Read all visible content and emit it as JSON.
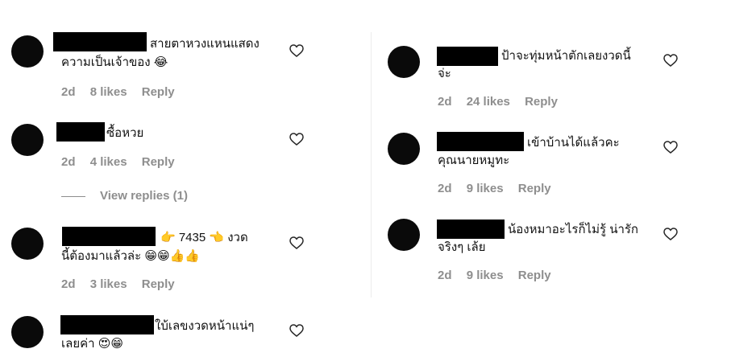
{
  "left": [
    {
      "text1": "สายตาหวงแหนแสดง",
      "text2": "ความเป็นเจ้าของ 😂",
      "time": "2d",
      "likes": "8 likes",
      "reply": "Reply"
    },
    {
      "text1": "ซื้อหวย",
      "text2": "",
      "time": "2d",
      "likes": "4 likes",
      "reply": "Reply",
      "view_replies": "View replies (1)"
    },
    {
      "text1": "👉 7435 👈 งวด",
      "text2": "นี้ต้องมาแล้วล่ะ 😁😁👍👍",
      "time": "2d",
      "likes": "3 likes",
      "reply": "Reply"
    },
    {
      "text1": "ใบ้เลขงวดหน้าแน่ๆ",
      "text2": "เลยค่า 😍😁"
    }
  ],
  "right": [
    {
      "text1": "ป้าจะทุ่มหน้าตักเลยงวดนี้",
      "text2": "จ่ะ",
      "time": "2d",
      "likes": "24 likes",
      "reply": "Reply"
    },
    {
      "text1": "เข้าบ้านได้แล้วคะ",
      "text2": "คุณนายหมูทะ",
      "time": "2d",
      "likes": "9 likes",
      "reply": "Reply"
    },
    {
      "text1": "น้องหมาอะไรก็ไม่รู้ น่ารัก",
      "text2": "จริงๆ เล้ย",
      "time": "2d",
      "likes": "9 likes",
      "reply": "Reply"
    }
  ],
  "icons": {
    "like": "heart-icon"
  }
}
